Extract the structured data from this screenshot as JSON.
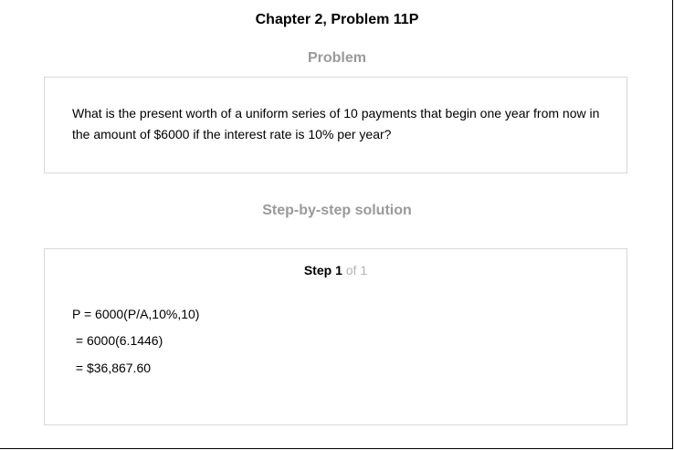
{
  "header": {
    "title": "Chapter 2, Problem 11P"
  },
  "problem": {
    "heading": "Problem",
    "text": "What is the present worth of a uniform series of 10 payments that begin one year from now in the amount of $6000 if the interest rate is 10% per year?"
  },
  "solution": {
    "heading": "Step-by-step solution",
    "step": {
      "word": "Step",
      "number": "1",
      "of": "of",
      "total": "1"
    },
    "lines": [
      "P = 6000(P/A,10%,10)",
      " = 6000(6.1446)",
      " = $36,867.60"
    ]
  },
  "colors": {
    "heading_gray": "#9a9a9a",
    "card_border": "#d9d9d9",
    "step_of_gray": "#b3b3b3"
  }
}
